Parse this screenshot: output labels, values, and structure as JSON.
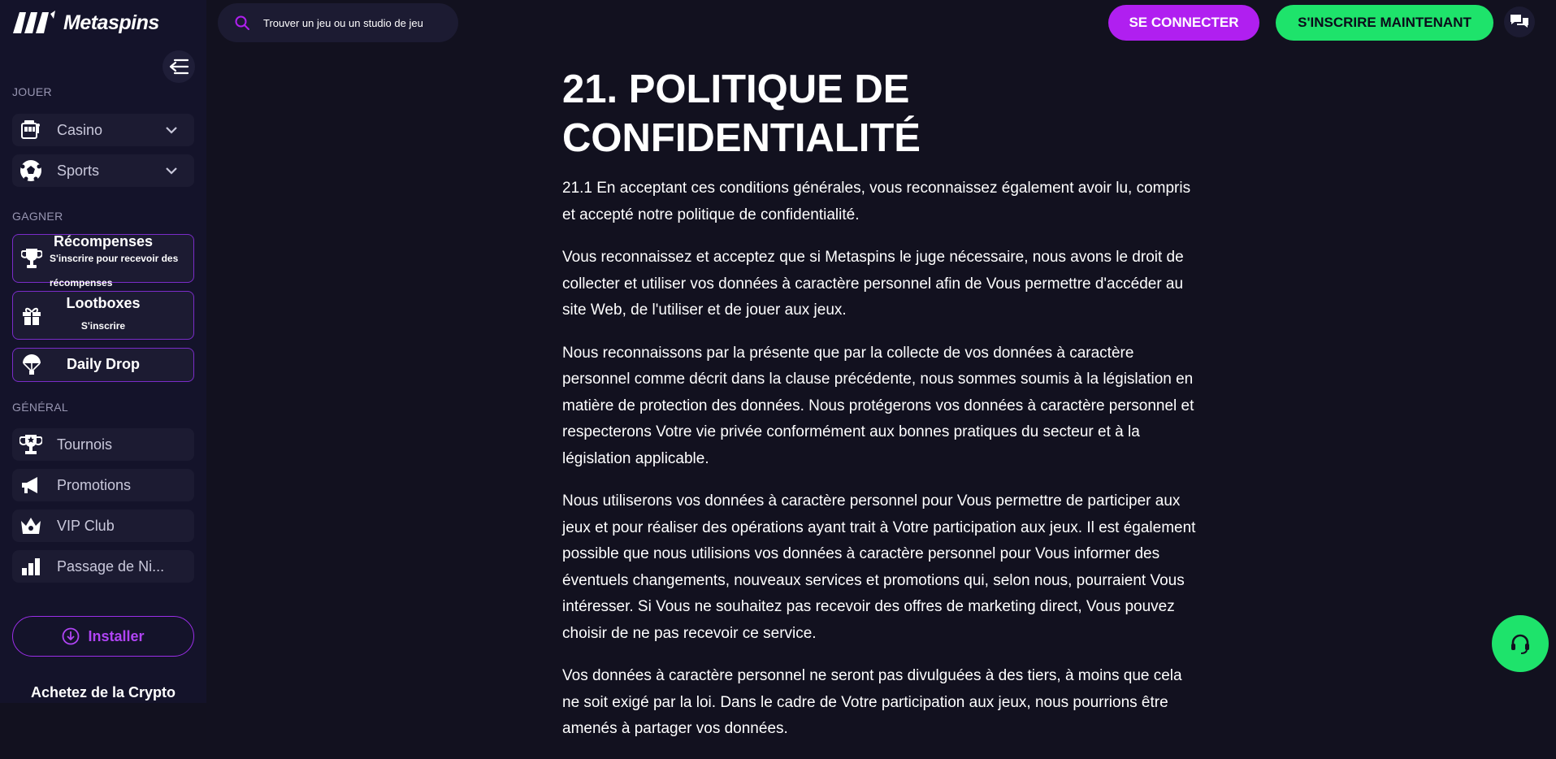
{
  "brand": {
    "name": "Metaspins"
  },
  "header": {
    "search_placeholder": "Trouver un jeu ou un studio de jeu",
    "login_label": "SE CONNECTER",
    "signup_label": "S'INSCRIRE MAINTENANT"
  },
  "sidebar": {
    "play_section": "JOUER",
    "play_items": [
      {
        "label": "Casino",
        "icon": "slot-machine-icon"
      },
      {
        "label": "Sports",
        "icon": "soccer-ball-icon"
      }
    ],
    "earn_section": "GAGNER",
    "rewards": {
      "title": "Récompenses",
      "subtitle_line1": "S'inscrire pour recevoir des",
      "subtitle_line2": "récompenses"
    },
    "lootboxes": {
      "title": "Lootboxes",
      "subtitle": "S'inscrire"
    },
    "daily_drop": {
      "title": "Daily Drop"
    },
    "general_section": "GÉNÉRAL",
    "general_items": [
      {
        "label": "Tournois",
        "icon": "trophy-icon"
      },
      {
        "label": "Promotions",
        "icon": "megaphone-icon"
      },
      {
        "label": "VIP Club",
        "icon": "crown-icon"
      },
      {
        "label": "Passage de Ni...",
        "icon": "bar-chart-icon"
      }
    ],
    "install_label": "Installer",
    "crypto_label": "Achetez de la Crypto"
  },
  "main": {
    "title": "21. POLITIQUE DE CONFIDENTIALITÉ",
    "paragraphs": [
      "21.1 En acceptant ces conditions générales, vous reconnaissez également avoir lu, compris et accepté notre politique de confidentialité.",
      "Vous reconnaissez et acceptez que si Metaspins le juge nécessaire, nous avons le droit de collecter et utiliser vos données à caractère personnel afin de Vous permettre d'accéder au site Web, de l'utiliser et de jouer aux jeux.",
      "Nous reconnaissons par la présente que par la collecte de vos données à caractère personnel comme décrit dans la clause précédente, nous sommes soumis à la législation en matière de protection des données. Nous protégerons vos données à caractère personnel et respecterons Votre vie privée conformément aux bonnes pratiques du secteur et à la législation applicable.",
      "Nous utiliserons vos données à caractère personnel pour Vous permettre de participer aux jeux et pour réaliser des opérations ayant trait à Votre participation aux jeux. Il est également possible que nous utilisions vos données à caractère personnel pour Vous informer des éventuels changements, nouveaux services et promotions qui, selon nous, pourraient Vous intéresser. Si Vous ne souhaitez pas recevoir des offres de marketing direct, Vous pouvez choisir de ne pas recevoir ce service.",
      "Vos données à caractère personnel ne seront pas divulguées à des tiers, à moins que cela ne soit exigé par la loi. Dans le cadre de Votre participation aux jeux, nous pourrions être amenés à partager vos données."
    ]
  },
  "colors": {
    "background": "#12111f",
    "sidebar": "#14132a",
    "accent_purple": "#b01ff0",
    "accent_green": "#1ee36b"
  }
}
